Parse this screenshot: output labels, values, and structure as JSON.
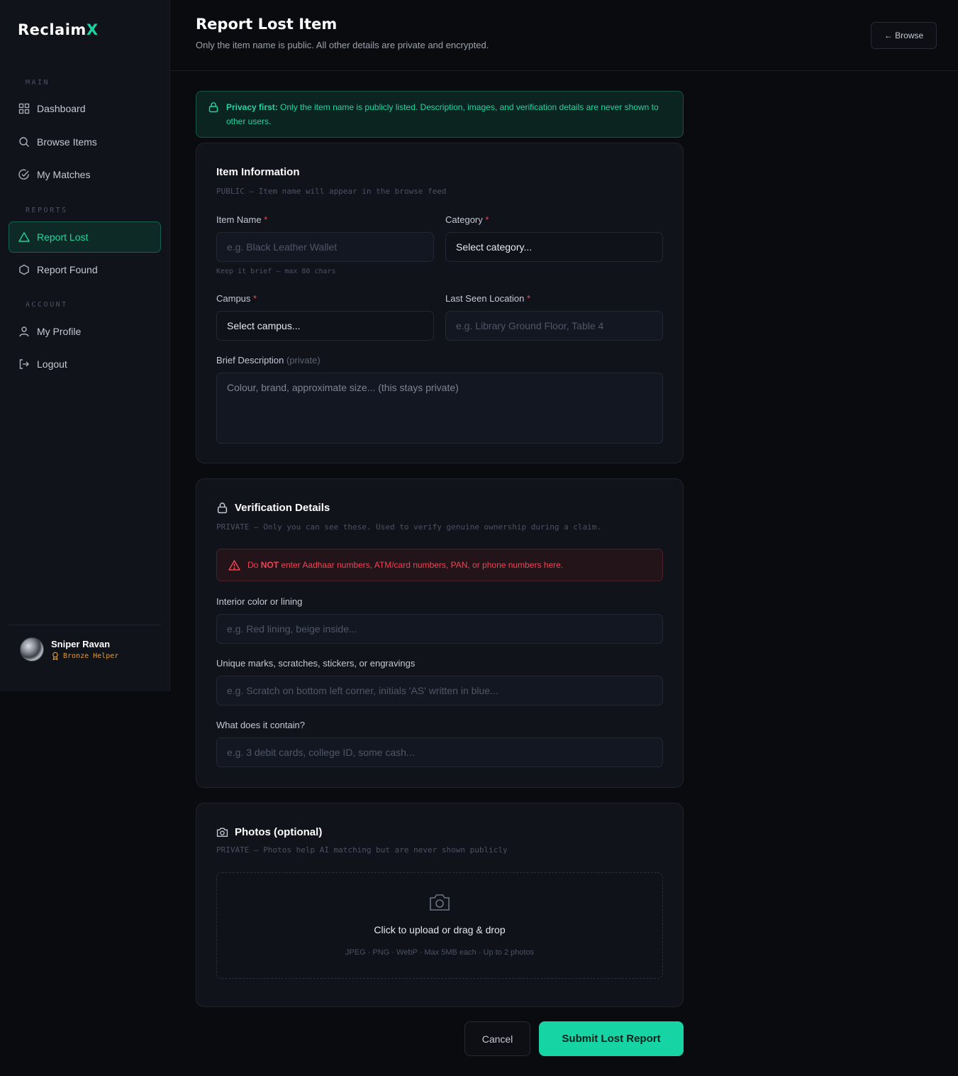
{
  "app": {
    "logo_main": "Reclaim",
    "logo_accent": "X"
  },
  "colors": {
    "accent": "#16d4a3",
    "danger": "#ef4455",
    "badge": "#e19a35",
    "background": "#0a0b0f"
  },
  "sidebar": {
    "sections": {
      "main": "MAIN",
      "reports": "REPORTS",
      "account": "ACCOUNT"
    },
    "items": [
      {
        "label": "Dashboard",
        "icon": "grid-icon"
      },
      {
        "label": "Browse Items",
        "icon": "search-icon"
      },
      {
        "label": "My Matches",
        "icon": "check-circle-icon"
      },
      {
        "label": "Report Lost",
        "icon": "triangle-icon",
        "active": true
      },
      {
        "label": "Report Found",
        "icon": "hexagon-icon"
      },
      {
        "label": "My Profile",
        "icon": "user-icon"
      },
      {
        "label": "Logout",
        "icon": "logout-icon"
      }
    ],
    "user": {
      "name": "Sniper Ravan",
      "badge": "Bronze Helper"
    }
  },
  "header": {
    "title": "Report Lost Item",
    "subtitle": "Only the item name is public. All other details are private and encrypted.",
    "browse_label": "← Browse"
  },
  "privacy_banner": {
    "strong": "Privacy first:",
    "text": " Only the item name is publicly listed. Description, images, and verification details are never shown to other users."
  },
  "item_info": {
    "title": "Item Information",
    "subtitle": "PUBLIC — Item name will appear in the browse feed",
    "item_name": {
      "label": "Item Name",
      "placeholder": "e.g. Black Leather Wallet",
      "hint": "Keep it brief — max 80 chars"
    },
    "category": {
      "label": "Category",
      "value": "Select category..."
    },
    "campus": {
      "label": "Campus",
      "value": "Select campus..."
    },
    "location": {
      "label": "Last Seen Location",
      "placeholder": "e.g. Library Ground Floor, Table 4"
    },
    "description": {
      "label": "Brief Description",
      "label_note": "(private)",
      "placeholder": "Colour, brand, approximate size... (this stays private)"
    },
    "required_mark": "*"
  },
  "verification": {
    "title": "Verification Details",
    "subtitle": "PRIVATE — Only you can see these. Used to verify genuine ownership during a claim.",
    "warning_pre": "Do ",
    "warning_strong": "NOT",
    "warning_post": " enter Aadhaar numbers, ATM/card numbers, PAN, or phone numbers here.",
    "interior": {
      "label": "Interior color or lining",
      "placeholder": "e.g. Red lining, beige inside..."
    },
    "marks": {
      "label": "Unique marks, scratches, stickers, or engravings",
      "placeholder": "e.g. Scratch on bottom left corner, initials 'AS' written in blue..."
    },
    "contents": {
      "label": "What does it contain?",
      "placeholder": "e.g. 3 debit cards, college ID, some cash..."
    }
  },
  "photos": {
    "title": "Photos (optional)",
    "subtitle": "PRIVATE — Photos help AI matching but are never shown publicly",
    "upload_main": "Click to upload or drag & drop",
    "upload_sub": "JPEG · PNG · WebP · Max 5MB each · Up to 2 photos"
  },
  "actions": {
    "cancel": "Cancel",
    "submit": "Submit Lost Report"
  }
}
